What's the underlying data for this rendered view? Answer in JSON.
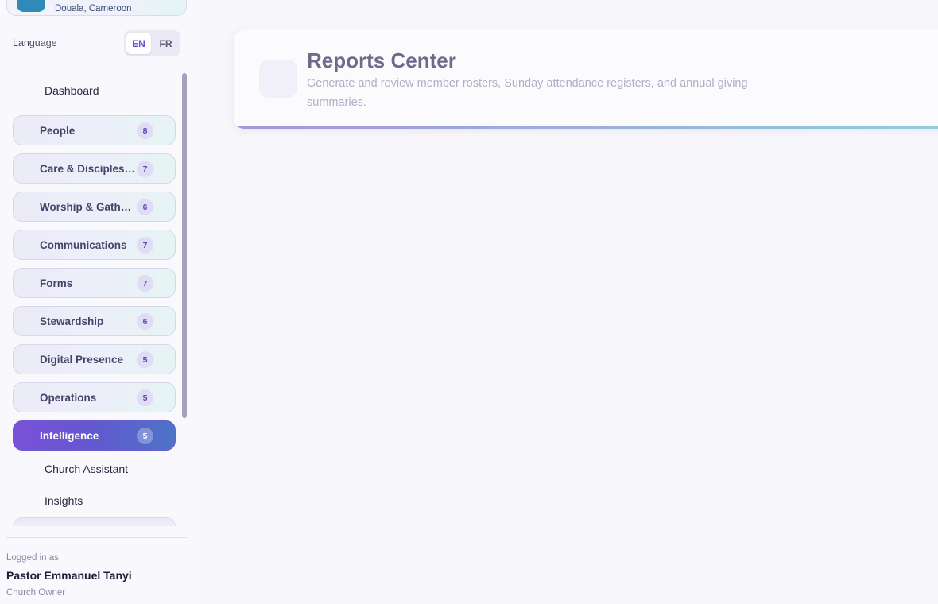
{
  "church": {
    "location": "Douala, Cameroon"
  },
  "language": {
    "label": "Language",
    "options": [
      "EN",
      "FR"
    ],
    "selected": "EN"
  },
  "nav": {
    "dashboard": "Dashboard",
    "groups": [
      {
        "label": "People",
        "count": "8"
      },
      {
        "label": "Care & Discipleship",
        "count": "7"
      },
      {
        "label": "Worship & Gatherings",
        "count": "6"
      },
      {
        "label": "Communications",
        "count": "7"
      },
      {
        "label": "Forms",
        "count": "7"
      },
      {
        "label": "Stewardship",
        "count": "6"
      },
      {
        "label": "Digital Presence",
        "count": "5"
      },
      {
        "label": "Operations",
        "count": "5"
      },
      {
        "label": "Intelligence",
        "count": "5",
        "active": true
      }
    ],
    "intelligence_items": [
      "Church Assistant",
      "Insights"
    ]
  },
  "user": {
    "logged_in_label": "Logged in as",
    "name": "Pastor Emmanuel Tanyi",
    "role": "Church Owner"
  },
  "page": {
    "title": "Reports Center",
    "subtitle": "Generate and review member rosters, Sunday attendance registers, and annual giving summaries."
  },
  "colors": {
    "accent": "#6a4fd0",
    "active_group_start": "#7a51d8",
    "active_group_end": "#4d74c6",
    "church_logo": "#2f8ab8"
  }
}
